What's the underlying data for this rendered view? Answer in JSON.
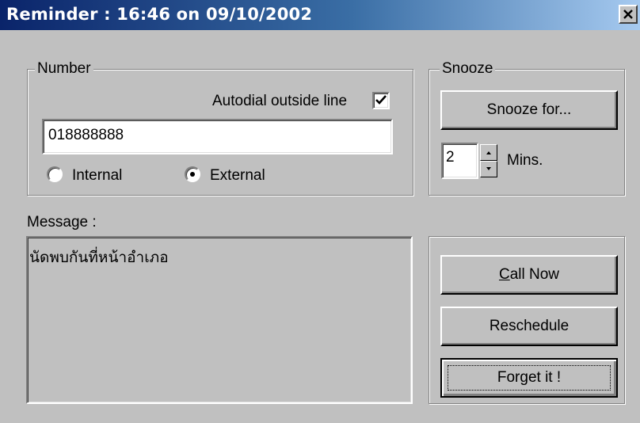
{
  "window": {
    "title": "Reminder : 16:46 on 09/10/2002",
    "close_icon": "close-icon"
  },
  "number_group": {
    "legend": "Number",
    "autodial_label": "Autodial outside line",
    "autodial_checked": true,
    "number_value": "018888888",
    "radio_internal_label": "Internal",
    "radio_external_label": "External",
    "selected": "External"
  },
  "snooze_group": {
    "legend": "Snooze",
    "snooze_button": "Snooze for...",
    "minutes_value": "2",
    "mins_label": "Mins."
  },
  "message": {
    "label": "Message :",
    "text": "นัดพบกันที่หน้าอำเภอ"
  },
  "actions": {
    "call_now_mnemonic": "C",
    "call_now_rest": "all Now",
    "reschedule": "Reschedule",
    "forget": "Forget it !"
  }
}
